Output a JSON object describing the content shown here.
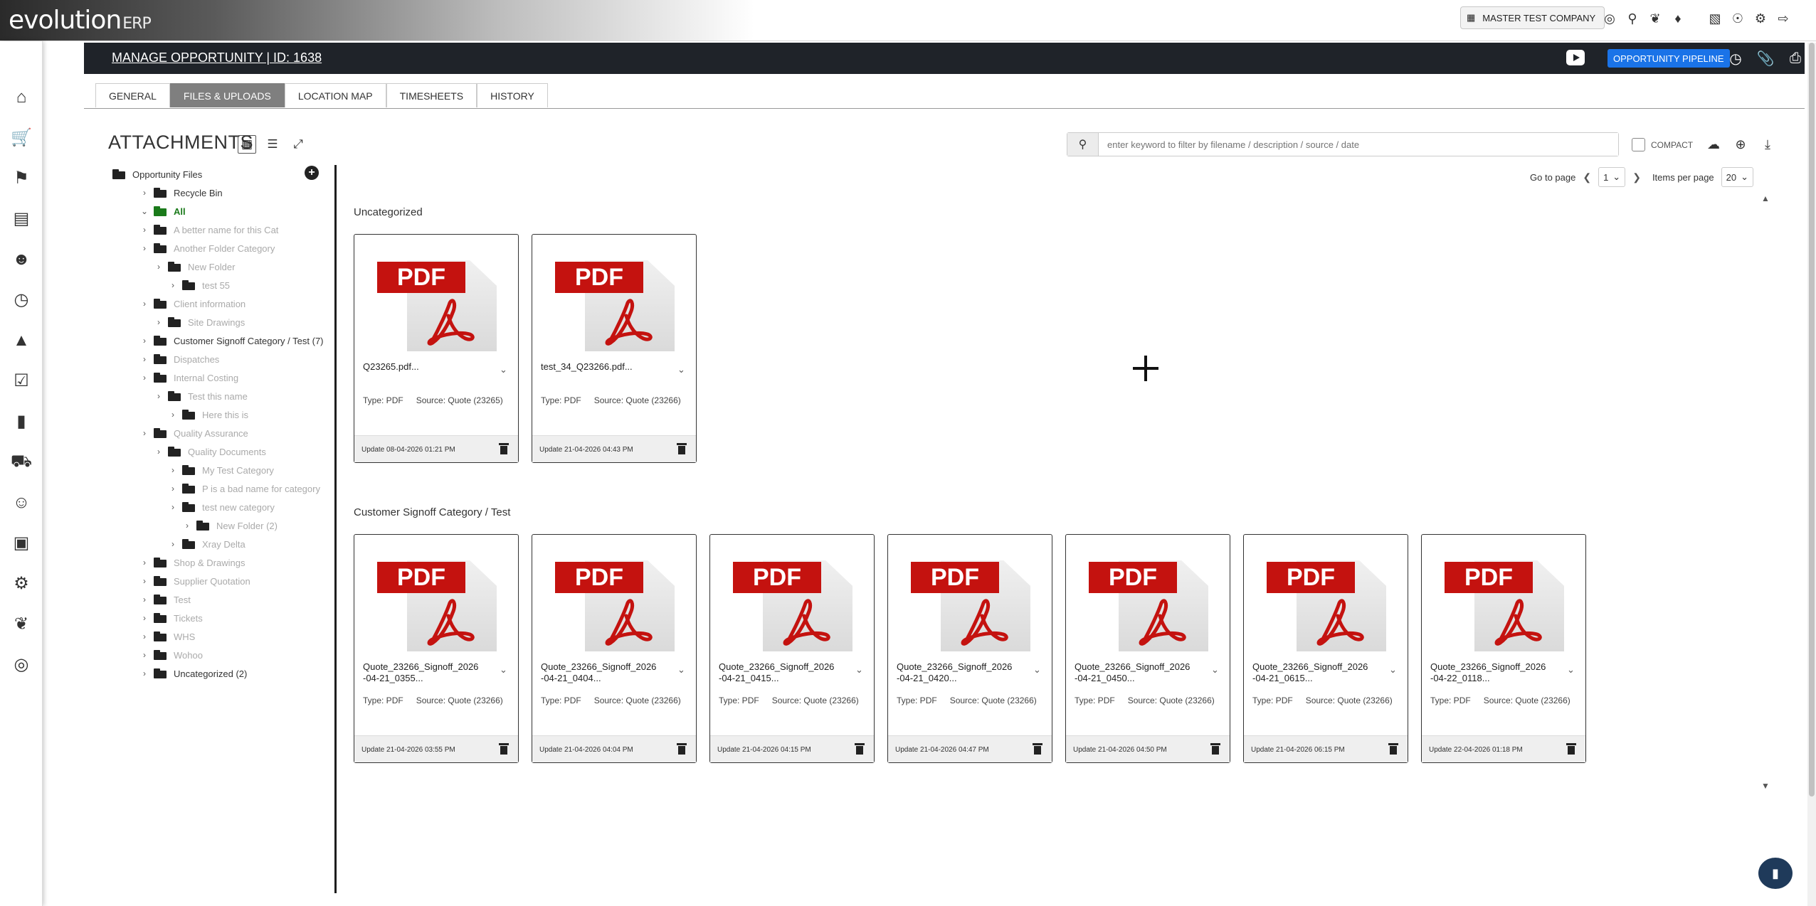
{
  "app": {
    "logo_main": "evolution",
    "logo_suffix": "ERP"
  },
  "topbar": {
    "company": "MASTER TEST COMPANY",
    "icons": [
      "support-icon",
      "search-icon",
      "puzzle-icon",
      "bell-icon",
      "calendar-icon",
      "user-icon",
      "settings-icon",
      "logout-icon"
    ]
  },
  "sidebar": {
    "icons": [
      "home-icon",
      "cart-icon",
      "tag-icon",
      "bank-icon",
      "user-assign-icon",
      "clock-icon",
      "factory-icon",
      "checklist-icon",
      "chart-icon",
      "vehicle-icon",
      "people-icon",
      "toolbox-icon",
      "gear-icon",
      "plugin-icon",
      "support-icon"
    ]
  },
  "header": {
    "title": "MANAGE OPPORTUNITY | ID: 1638",
    "pipeline_label": "OPPORTUNITY PIPELINE"
  },
  "tabs": [
    {
      "label": "GENERAL",
      "active": false
    },
    {
      "label": "FILES & UPLOADS",
      "active": true
    },
    {
      "label": "LOCATION MAP",
      "active": false
    },
    {
      "label": "TIMESHEETS",
      "active": false
    },
    {
      "label": "HISTORY",
      "active": false
    }
  ],
  "attachments": {
    "title": "ATTACHMENTS",
    "search_placeholder": "enter keyword to filter by filename / description / source / date",
    "compact_label": "COMPACT",
    "go_to_page_label": "Go to page",
    "page_value": "1",
    "items_per_page_label": "Items per page",
    "items_per_page_value": "20"
  },
  "tree": [
    {
      "label": "Opportunity Files",
      "indent": 0,
      "style": "dark",
      "chev": ""
    },
    {
      "label": "Recycle Bin",
      "indent": 1,
      "style": "dark",
      "chev": ">"
    },
    {
      "label": "All",
      "indent": 1,
      "style": "green",
      "chev": "v"
    },
    {
      "label": "A better name for this Cat",
      "indent": 1,
      "style": "muted",
      "chev": ">"
    },
    {
      "label": "Another Folder Category",
      "indent": 1,
      "style": "muted",
      "chev": ">"
    },
    {
      "label": "New Folder",
      "indent": 2,
      "style": "muted",
      "chev": ">"
    },
    {
      "label": "test 55",
      "indent": 3,
      "style": "muted",
      "chev": ">"
    },
    {
      "label": "Client information",
      "indent": 1,
      "style": "muted",
      "chev": ">"
    },
    {
      "label": "Site Drawings",
      "indent": 2,
      "style": "muted",
      "chev": ">"
    },
    {
      "label": "Customer Signoff Category / Test (7)",
      "indent": 1,
      "style": "dark",
      "chev": ">"
    },
    {
      "label": "Dispatches",
      "indent": 1,
      "style": "muted",
      "chev": ">"
    },
    {
      "label": "Internal Costing",
      "indent": 1,
      "style": "muted",
      "chev": ">"
    },
    {
      "label": "Test this name",
      "indent": 2,
      "style": "muted",
      "chev": ">"
    },
    {
      "label": "Here this is",
      "indent": 3,
      "style": "muted",
      "chev": ">"
    },
    {
      "label": "Quality Assurance",
      "indent": 1,
      "style": "muted",
      "chev": ">"
    },
    {
      "label": "Quality Documents",
      "indent": 2,
      "style": "muted",
      "chev": ">"
    },
    {
      "label": "My Test Category",
      "indent": 3,
      "style": "muted",
      "chev": ">"
    },
    {
      "label": "P is a bad name for category",
      "indent": 3,
      "style": "muted",
      "chev": ">"
    },
    {
      "label": "test new category",
      "indent": 3,
      "style": "muted",
      "chev": ">"
    },
    {
      "label": "New Folder (2)",
      "indent": 4,
      "style": "muted",
      "chev": ">"
    },
    {
      "label": "Xray Delta",
      "indent": 3,
      "style": "muted",
      "chev": ">"
    },
    {
      "label": "Shop & Drawings",
      "indent": 1,
      "style": "muted",
      "chev": ">"
    },
    {
      "label": "Supplier Quotation",
      "indent": 1,
      "style": "muted",
      "chev": ">"
    },
    {
      "label": "Test",
      "indent": 1,
      "style": "muted",
      "chev": ">"
    },
    {
      "label": "Tickets",
      "indent": 1,
      "style": "muted",
      "chev": ">"
    },
    {
      "label": "WHS",
      "indent": 1,
      "style": "muted",
      "chev": ">"
    },
    {
      "label": "Wohoo",
      "indent": 1,
      "style": "muted",
      "chev": ">"
    },
    {
      "label": "Uncategorized (2)",
      "indent": 1,
      "style": "dark",
      "chev": ">"
    }
  ],
  "sections": [
    {
      "title": "Uncategorized",
      "files": [
        {
          "name": "Q23265.pdf...",
          "type": "Type: PDF",
          "source": "Source: Quote (23265)",
          "updated": "Update 08-04-2026 01:21 PM"
        },
        {
          "name": "test_34_Q23266.pdf...",
          "type": "Type: PDF",
          "source": "Source: Quote (23266)",
          "updated": "Update 21-04-2026 04:43 PM"
        }
      ]
    },
    {
      "title": "Customer Signoff Category / Test",
      "files": [
        {
          "name": "Quote_23266_Signoff_2026\n-04-21_0355...",
          "type": "Type: PDF",
          "source": "Source: Quote (23266)",
          "updated": "Update 21-04-2026 03:55 PM"
        },
        {
          "name": "Quote_23266_Signoff_2026\n-04-21_0404...",
          "type": "Type: PDF",
          "source": "Source: Quote (23266)",
          "updated": "Update 21-04-2026 04:04 PM"
        },
        {
          "name": "Quote_23266_Signoff_2026\n-04-21_0415...",
          "type": "Type: PDF",
          "source": "Source: Quote (23266)",
          "updated": "Update 21-04-2026 04:15 PM"
        },
        {
          "name": "Quote_23266_Signoff_2026\n-04-21_0420...",
          "type": "Type: PDF",
          "source": "Source: Quote (23266)",
          "updated": "Update 21-04-2026 04:47 PM"
        },
        {
          "name": "Quote_23266_Signoff_2026\n-04-21_0450...",
          "type": "Type: PDF",
          "source": "Source: Quote (23266)",
          "updated": "Update 21-04-2026 04:50 PM"
        },
        {
          "name": "Quote_23266_Signoff_2026\n-04-21_0615...",
          "type": "Type: PDF",
          "source": "Source: Quote (23266)",
          "updated": "Update 21-04-2026 06:15 PM"
        },
        {
          "name": "Quote_23266_Signoff_2026\n-04-22_0118...",
          "type": "Type: PDF",
          "source": "Source: Quote (23266)",
          "updated": "Update 22-04-2026 01:18 PM"
        }
      ]
    }
  ],
  "pdf_label": "PDF",
  "colors": {
    "header_bg": "#1f2329",
    "accent": "#1a73e8",
    "pdf_red": "#c4120f",
    "active_folder": "#1a7a1a"
  }
}
